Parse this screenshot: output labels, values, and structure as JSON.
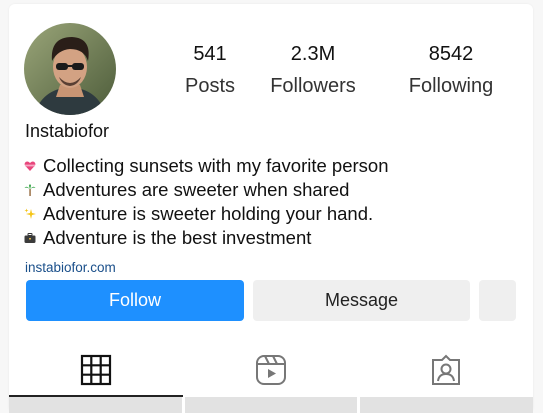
{
  "profile": {
    "username": "Instabiofor",
    "link": "instabiofor.com"
  },
  "stats": [
    {
      "value": "541",
      "label": "Posts"
    },
    {
      "value": "2.3M",
      "label": "Followers"
    },
    {
      "value": "8542",
      "label": "Following"
    }
  ],
  "bio": [
    {
      "icon": "heart-ribbon-icon",
      "text": "Collecting sunsets with my favorite person"
    },
    {
      "icon": "palm-tree-icon",
      "text": "Adventures are sweeter when shared"
    },
    {
      "icon": "sparkles-icon",
      "text": "Adventure is sweeter holding your hand."
    },
    {
      "icon": "briefcase-icon",
      "text": "Adventure is the best investment"
    }
  ],
  "actions": {
    "follow_label": "Follow",
    "message_label": "Message"
  },
  "tabs": [
    {
      "icon": "grid-icon",
      "active": true
    },
    {
      "icon": "reels-icon",
      "active": false
    },
    {
      "icon": "tagged-icon",
      "active": false
    }
  ],
  "colors": {
    "follow": "#1e90ff",
    "secondary_button": "#efefef",
    "link": "#1a4f8a"
  }
}
